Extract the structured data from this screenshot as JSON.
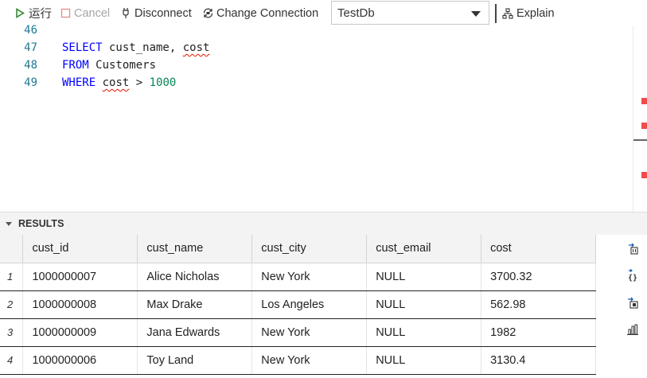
{
  "toolbar": {
    "run_label": "运行",
    "cancel_label": "Cancel",
    "disconnect_label": "Disconnect",
    "change_connection_label": "Change Connection",
    "database_selected": "TestDb",
    "explain_label": "Explain"
  },
  "editor": {
    "lines": [
      {
        "number": "46",
        "text": ""
      },
      {
        "number": "47",
        "keyword": "SELECT",
        "text": " cust_name, ",
        "squiggle": "cost"
      },
      {
        "number": "48",
        "keyword": "FROM",
        "text": " Customers"
      },
      {
        "number": "49",
        "keyword": "WHERE",
        "squiggle": "cost",
        "text": " > ",
        "number_literal": "1000"
      }
    ]
  },
  "results": {
    "title": "RESULTS",
    "columns": [
      "cust_id",
      "cust_name",
      "cust_city",
      "cust_email",
      "cost"
    ],
    "rows": [
      {
        "index": "1",
        "cells": [
          "1000000007",
          "Alice Nicholas",
          "New York",
          "NULL",
          "3700.32"
        ]
      },
      {
        "index": "2",
        "cells": [
          "1000000008",
          "Max Drake",
          "Los Angeles",
          "NULL",
          "562.98"
        ]
      },
      {
        "index": "3",
        "cells": [
          "1000000009",
          "Jana Edwards",
          "New York",
          "NULL",
          "1982"
        ]
      },
      {
        "index": "4",
        "cells": [
          "1000000006",
          "Toy Land",
          "New York",
          "NULL",
          "3130.4"
        ]
      }
    ],
    "side_actions": [
      {
        "icon": "save-as-csv-icon"
      },
      {
        "icon": "save-as-json-icon"
      },
      {
        "icon": "save-as-excel-icon"
      },
      {
        "icon": "chart-icon"
      }
    ]
  },
  "colors": {
    "keyword": "#0000ff",
    "number_literal": "#098658",
    "line_number": "#237893",
    "error_squiggle": "#e51400",
    "run_icon": "#388a34"
  }
}
